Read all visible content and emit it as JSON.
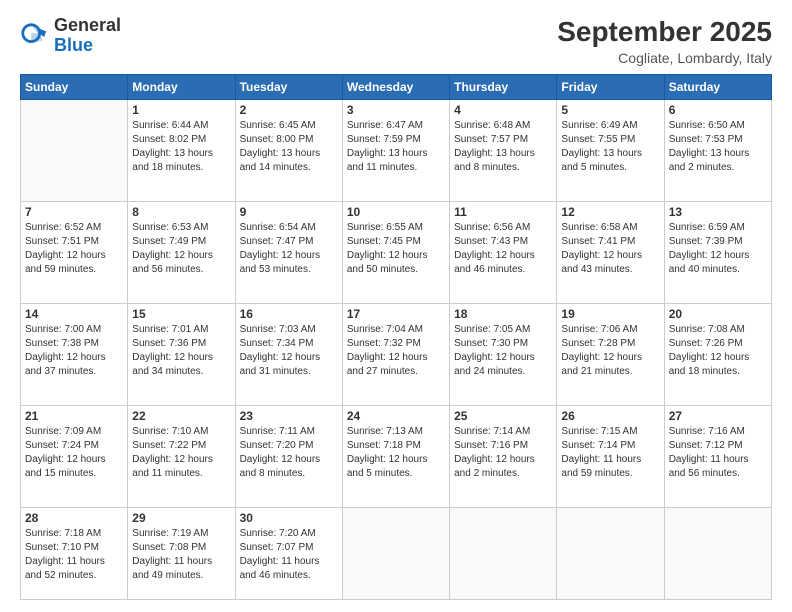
{
  "logo": {
    "general": "General",
    "blue": "Blue"
  },
  "header": {
    "title": "September 2025",
    "location": "Cogliate, Lombardy, Italy"
  },
  "weekdays": [
    "Sunday",
    "Monday",
    "Tuesday",
    "Wednesday",
    "Thursday",
    "Friday",
    "Saturday"
  ],
  "weeks": [
    [
      {
        "day": "",
        "info": ""
      },
      {
        "day": "1",
        "info": "Sunrise: 6:44 AM\nSunset: 8:02 PM\nDaylight: 13 hours\nand 18 minutes."
      },
      {
        "day": "2",
        "info": "Sunrise: 6:45 AM\nSunset: 8:00 PM\nDaylight: 13 hours\nand 14 minutes."
      },
      {
        "day": "3",
        "info": "Sunrise: 6:47 AM\nSunset: 7:59 PM\nDaylight: 13 hours\nand 11 minutes."
      },
      {
        "day": "4",
        "info": "Sunrise: 6:48 AM\nSunset: 7:57 PM\nDaylight: 13 hours\nand 8 minutes."
      },
      {
        "day": "5",
        "info": "Sunrise: 6:49 AM\nSunset: 7:55 PM\nDaylight: 13 hours\nand 5 minutes."
      },
      {
        "day": "6",
        "info": "Sunrise: 6:50 AM\nSunset: 7:53 PM\nDaylight: 13 hours\nand 2 minutes."
      }
    ],
    [
      {
        "day": "7",
        "info": "Sunrise: 6:52 AM\nSunset: 7:51 PM\nDaylight: 12 hours\nand 59 minutes."
      },
      {
        "day": "8",
        "info": "Sunrise: 6:53 AM\nSunset: 7:49 PM\nDaylight: 12 hours\nand 56 minutes."
      },
      {
        "day": "9",
        "info": "Sunrise: 6:54 AM\nSunset: 7:47 PM\nDaylight: 12 hours\nand 53 minutes."
      },
      {
        "day": "10",
        "info": "Sunrise: 6:55 AM\nSunset: 7:45 PM\nDaylight: 12 hours\nand 50 minutes."
      },
      {
        "day": "11",
        "info": "Sunrise: 6:56 AM\nSunset: 7:43 PM\nDaylight: 12 hours\nand 46 minutes."
      },
      {
        "day": "12",
        "info": "Sunrise: 6:58 AM\nSunset: 7:41 PM\nDaylight: 12 hours\nand 43 minutes."
      },
      {
        "day": "13",
        "info": "Sunrise: 6:59 AM\nSunset: 7:39 PM\nDaylight: 12 hours\nand 40 minutes."
      }
    ],
    [
      {
        "day": "14",
        "info": "Sunrise: 7:00 AM\nSunset: 7:38 PM\nDaylight: 12 hours\nand 37 minutes."
      },
      {
        "day": "15",
        "info": "Sunrise: 7:01 AM\nSunset: 7:36 PM\nDaylight: 12 hours\nand 34 minutes."
      },
      {
        "day": "16",
        "info": "Sunrise: 7:03 AM\nSunset: 7:34 PM\nDaylight: 12 hours\nand 31 minutes."
      },
      {
        "day": "17",
        "info": "Sunrise: 7:04 AM\nSunset: 7:32 PM\nDaylight: 12 hours\nand 27 minutes."
      },
      {
        "day": "18",
        "info": "Sunrise: 7:05 AM\nSunset: 7:30 PM\nDaylight: 12 hours\nand 24 minutes."
      },
      {
        "day": "19",
        "info": "Sunrise: 7:06 AM\nSunset: 7:28 PM\nDaylight: 12 hours\nand 21 minutes."
      },
      {
        "day": "20",
        "info": "Sunrise: 7:08 AM\nSunset: 7:26 PM\nDaylight: 12 hours\nand 18 minutes."
      }
    ],
    [
      {
        "day": "21",
        "info": "Sunrise: 7:09 AM\nSunset: 7:24 PM\nDaylight: 12 hours\nand 15 minutes."
      },
      {
        "day": "22",
        "info": "Sunrise: 7:10 AM\nSunset: 7:22 PM\nDaylight: 12 hours\nand 11 minutes."
      },
      {
        "day": "23",
        "info": "Sunrise: 7:11 AM\nSunset: 7:20 PM\nDaylight: 12 hours\nand 8 minutes."
      },
      {
        "day": "24",
        "info": "Sunrise: 7:13 AM\nSunset: 7:18 PM\nDaylight: 12 hours\nand 5 minutes."
      },
      {
        "day": "25",
        "info": "Sunrise: 7:14 AM\nSunset: 7:16 PM\nDaylight: 12 hours\nand 2 minutes."
      },
      {
        "day": "26",
        "info": "Sunrise: 7:15 AM\nSunset: 7:14 PM\nDaylight: 11 hours\nand 59 minutes."
      },
      {
        "day": "27",
        "info": "Sunrise: 7:16 AM\nSunset: 7:12 PM\nDaylight: 11 hours\nand 56 minutes."
      }
    ],
    [
      {
        "day": "28",
        "info": "Sunrise: 7:18 AM\nSunset: 7:10 PM\nDaylight: 11 hours\nand 52 minutes."
      },
      {
        "day": "29",
        "info": "Sunrise: 7:19 AM\nSunset: 7:08 PM\nDaylight: 11 hours\nand 49 minutes."
      },
      {
        "day": "30",
        "info": "Sunrise: 7:20 AM\nSunset: 7:07 PM\nDaylight: 11 hours\nand 46 minutes."
      },
      {
        "day": "",
        "info": ""
      },
      {
        "day": "",
        "info": ""
      },
      {
        "day": "",
        "info": ""
      },
      {
        "day": "",
        "info": ""
      }
    ]
  ]
}
